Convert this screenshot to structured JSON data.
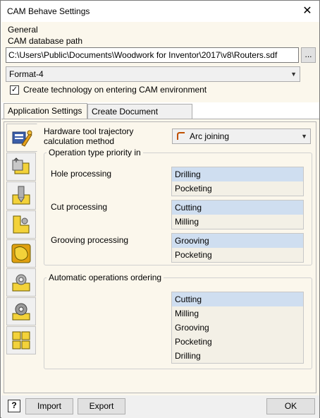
{
  "window": {
    "title": "CAM Behave Settings",
    "close_glyph": "✕"
  },
  "general": {
    "heading": "General",
    "db_label": "CAM database path",
    "db_path": "C:\\Users\\Public\\Documents\\Woodwork for Inventor\\2017\\v8\\Routers.sdf",
    "browse_label": "...",
    "format_value": "Format-4",
    "create_tech_label": "Create technology on entering CAM environment",
    "create_tech_checked": true
  },
  "tabs": [
    {
      "label": "Application Settings",
      "active": true
    },
    {
      "label": "Create Document Settings",
      "active": false
    }
  ],
  "side_tabs": [
    "settings-wrench-icon",
    "folder-export-icon",
    "drill-icon",
    "profile-cut-icon",
    "groove-shape-icon",
    "gear-cut-icon",
    "gear-icon",
    "puzzle-icon"
  ],
  "content": {
    "trajectory_label_1": "Hardware tool trajectory",
    "trajectory_label_2": "calculation method",
    "trajectory_value": "Arc joining",
    "priority_title": "Operation type priority in",
    "hole_label": "Hole processing",
    "hole_items": [
      "Drilling",
      "Pocketing"
    ],
    "cut_label": "Cut processing",
    "cut_items": [
      "Cutting",
      "Milling"
    ],
    "groove_label": "Grooving processing",
    "groove_items": [
      "Grooving",
      "Pocketing"
    ],
    "ordering_title": "Automatic operations ordering",
    "ordering_items": [
      "Cutting",
      "Milling",
      "Grooving",
      "Pocketing",
      "Drilling"
    ]
  },
  "footer": {
    "help_label": "?",
    "import_label": "Import",
    "export_label": "Export",
    "ok_label": "OK"
  }
}
